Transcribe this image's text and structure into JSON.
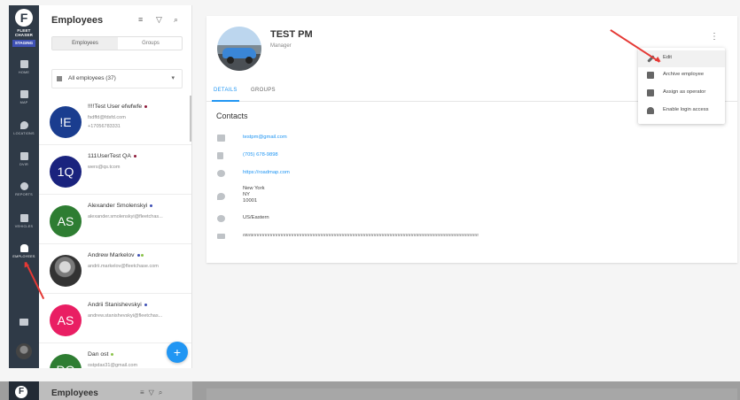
{
  "rail": {
    "brand_line1": "FLEET",
    "brand_line2": "CHASER",
    "staging_badge": "STAGING",
    "items": [
      {
        "label": "HOME",
        "icon": "home-icon"
      },
      {
        "label": "MAP",
        "icon": "map-icon"
      },
      {
        "label": "LOCATIONS",
        "icon": "location-pin-icon"
      },
      {
        "label": "DVIR",
        "icon": "clipboard-icon"
      },
      {
        "label": "REPORTS",
        "icon": "reports-icon"
      },
      {
        "label": "VEHICLES",
        "icon": "truck-icon"
      },
      {
        "label": "EMPLOYEES",
        "icon": "people-icon"
      }
    ]
  },
  "list": {
    "title": "Employees",
    "segment": {
      "employees": "Employees",
      "groups": "Groups"
    },
    "filter": {
      "value": "All employees (37)"
    },
    "rows": [
      {
        "initials": "!E",
        "name": "!!!!Test User efwfwfe",
        "line1": "fsdffd@fdsfd.com",
        "line2": "+17056783331",
        "color": "#1a3d8f",
        "dots": [
          "#8e1b3a"
        ]
      },
      {
        "initials": "1Q",
        "name": "111UserTest QA",
        "line1": "wers@qs.tcom",
        "line2": "",
        "color": "#1a237e",
        "dots": [
          "#8e1b3a"
        ]
      },
      {
        "initials": "AS",
        "name": "Alexander Smolenskyi",
        "line1": "alexander.smolenskyi@fleetchas...",
        "line2": "",
        "color": "#2e7d32",
        "dots": [
          "#3f51b5"
        ]
      },
      {
        "initials": "",
        "name": "Andrew Markelov",
        "line1": "andrii.markelov@fleetchase.com",
        "line2": "",
        "color": "#444444",
        "dots": [
          "#3f51b5",
          "#8bc34a"
        ]
      },
      {
        "initials": "AS",
        "name": "Andrii Stanishevskyi",
        "line1": "andrew.stanishevskyi@fleetchas...",
        "line2": "",
        "color": "#e91e63",
        "dots": [
          "#3f51b5"
        ]
      },
      {
        "initials": "DO",
        "name": "Dan ost",
        "line1": "ostpdax31@gmail.com",
        "line2": "",
        "color": "#2e7d32",
        "dots": [
          "#8bc34a"
        ]
      }
    ],
    "fab_label": "+"
  },
  "profile": {
    "name": "TEST PM",
    "role": "Manager",
    "tabs": [
      "DETAILS",
      "GROUPS"
    ],
    "section_title": "Contacts",
    "contacts": [
      {
        "icon": "email-icon",
        "text": "testpm@gmail.com",
        "link": true
      },
      {
        "icon": "phone-icon",
        "text": "(705) 678-9898",
        "link": true
      },
      {
        "icon": "globe-icon",
        "text": "https://roadmap.com",
        "link": true
      },
      {
        "icon": "location-icon",
        "text": "New York",
        "link": false
      },
      {
        "icon": "",
        "text": "NY",
        "link": false
      },
      {
        "icon": "",
        "text": "10001",
        "link": false
      },
      {
        "icon": "clock-icon",
        "text": "US/Eastern",
        "link": false
      },
      {
        "icon": "notes-icon",
        "text": "rtrtrrtrrrrrrrrrrrrrrrrrrrrrrrrrrrrrrrrrrrrrrrrrrrrrrrrrrrrrrrrrrrrrrrrrrrrrrrrrrrrrrrrrrrrrrrrrrrrrrrrrrrrrrrrrrrrrrrrrrrrrrrrrrrrrrrrrrrrrrrrrrrrrrrrrrrrrrrrrrrrrrrrrrrrrrrrrrr",
        "link": false
      }
    ]
  },
  "menu": {
    "items": [
      {
        "label": "Edit",
        "icon": "pencil-icon"
      },
      {
        "label": "Archive employee",
        "icon": "archive-icon"
      },
      {
        "label": "Assign as operator",
        "icon": "vehicle-icon"
      },
      {
        "label": "Enable login access",
        "icon": "person-key-icon"
      }
    ]
  },
  "strip": {
    "title": "Employees"
  },
  "colors": {
    "accent": "#2196f3",
    "rail": "#2f3a47",
    "arrow": "#e53935"
  }
}
